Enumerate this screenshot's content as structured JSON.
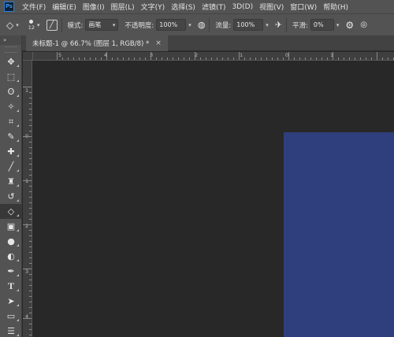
{
  "menubar": {
    "logo": "Ps",
    "items": [
      "文件(F)",
      "编辑(E)",
      "图像(I)",
      "图层(L)",
      "文字(Y)",
      "选择(S)",
      "滤镜(T)",
      "3D(D)",
      "视图(V)",
      "窗口(W)",
      "帮助(H)"
    ]
  },
  "options": {
    "brush_size": "12",
    "mode_label": "模式:",
    "mode_value": "画笔",
    "opacity_label": "不透明度:",
    "opacity_value": "100%",
    "flow_label": "流量:",
    "flow_value": "100%",
    "smoothing_label": "平滑:",
    "smoothing_value": "0%"
  },
  "toolbar": {
    "collapse": "»",
    "tools": [
      {
        "name": "move-tool",
        "icon": "✥"
      },
      {
        "name": "marquee-tool",
        "icon": "⬚"
      },
      {
        "name": "lasso-tool",
        "icon": "ʘ"
      },
      {
        "name": "quick-select-tool",
        "icon": "✧"
      },
      {
        "name": "crop-tool",
        "icon": "⌗"
      },
      {
        "name": "eyedropper-tool",
        "icon": "✎"
      },
      {
        "name": "healing-brush-tool",
        "icon": "✚"
      },
      {
        "name": "brush-tool",
        "icon": "╱"
      },
      {
        "name": "clone-stamp-tool",
        "icon": "♜"
      },
      {
        "name": "history-brush-tool",
        "icon": "↺"
      },
      {
        "name": "eraser-tool",
        "icon": "◇"
      },
      {
        "name": "gradient-tool",
        "icon": "▣"
      },
      {
        "name": "blur-tool",
        "icon": "●"
      },
      {
        "name": "dodge-tool",
        "icon": "◐"
      },
      {
        "name": "pen-tool",
        "icon": "✒"
      },
      {
        "name": "type-tool",
        "icon": "T"
      },
      {
        "name": "path-selection-tool",
        "icon": "➤"
      },
      {
        "name": "rectangle-tool",
        "icon": "▭"
      },
      {
        "name": "hand-tool",
        "icon": "☰"
      }
    ]
  },
  "document": {
    "tab_title": "未标题-1 @ 66.7% (图层 1, RGB/8) *",
    "tab_close": "×",
    "canvas_color": "#2f3f7e"
  },
  "rulers": {
    "h_labels": [
      "5",
      "4",
      "3",
      "2",
      "1",
      "0",
      "1"
    ],
    "v_labels": [
      "1",
      "0",
      "1",
      "2",
      "3",
      "4"
    ]
  }
}
